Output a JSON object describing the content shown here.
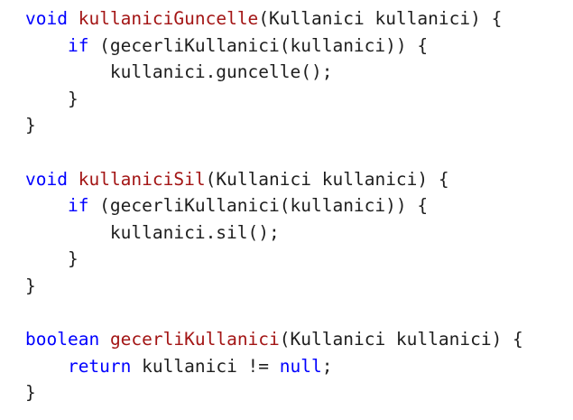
{
  "colors": {
    "background": "#ffffff",
    "keyword": "#0000ff",
    "method_name": "#a31515",
    "text": "#1e1e1e"
  },
  "lines": [
    {
      "indent": 0,
      "tokens": [
        {
          "t": "void",
          "c": "kw"
        },
        {
          "t": " ",
          "c": "tx"
        },
        {
          "t": "kullaniciGuncelle",
          "c": "fn"
        },
        {
          "t": "(Kullanici kullanici) {",
          "c": "tx"
        }
      ]
    },
    {
      "indent": 1,
      "tokens": [
        {
          "t": "if",
          "c": "kw"
        },
        {
          "t": " (gecerliKullanici(kullanici)) {",
          "c": "tx"
        }
      ]
    },
    {
      "indent": 2,
      "tokens": [
        {
          "t": "kullanici.guncelle();",
          "c": "tx"
        }
      ]
    },
    {
      "indent": 1,
      "tokens": [
        {
          "t": "}",
          "c": "tx"
        }
      ]
    },
    {
      "indent": 0,
      "tokens": [
        {
          "t": "}",
          "c": "tx"
        }
      ]
    },
    {
      "indent": 0,
      "tokens": []
    },
    {
      "indent": 0,
      "tokens": [
        {
          "t": "void",
          "c": "kw"
        },
        {
          "t": " ",
          "c": "tx"
        },
        {
          "t": "kullaniciSil",
          "c": "fn"
        },
        {
          "t": "(Kullanici kullanici) {",
          "c": "tx"
        }
      ]
    },
    {
      "indent": 1,
      "tokens": [
        {
          "t": "if",
          "c": "kw"
        },
        {
          "t": " (gecerliKullanici(kullanici)) {",
          "c": "tx"
        }
      ]
    },
    {
      "indent": 2,
      "tokens": [
        {
          "t": "kullanici.sil();",
          "c": "tx"
        }
      ]
    },
    {
      "indent": 1,
      "tokens": [
        {
          "t": "}",
          "c": "tx"
        }
      ]
    },
    {
      "indent": 0,
      "tokens": [
        {
          "t": "}",
          "c": "tx"
        }
      ]
    },
    {
      "indent": 0,
      "tokens": []
    },
    {
      "indent": 0,
      "tokens": [
        {
          "t": "boolean",
          "c": "kw"
        },
        {
          "t": " ",
          "c": "tx"
        },
        {
          "t": "gecerliKullanici",
          "c": "fn"
        },
        {
          "t": "(Kullanici kullanici) {",
          "c": "tx"
        }
      ]
    },
    {
      "indent": 1,
      "tokens": [
        {
          "t": "return",
          "c": "kw"
        },
        {
          "t": " kullanici != ",
          "c": "tx"
        },
        {
          "t": "null",
          "c": "kw"
        },
        {
          "t": ";",
          "c": "tx"
        }
      ]
    },
    {
      "indent": 0,
      "tokens": [
        {
          "t": "}",
          "c": "tx"
        }
      ]
    }
  ]
}
